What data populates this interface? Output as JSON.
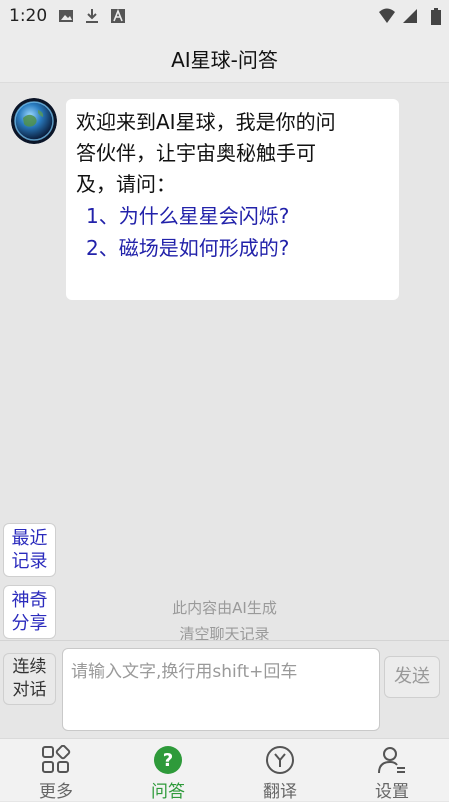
{
  "status_bar": {
    "time": "1:20"
  },
  "header": {
    "title": "AI星球-问答"
  },
  "chat": {
    "greeting_lines": [
      "欢迎来到AI星球，我是你的问",
      "答伙伴，让宇宙奥秘触手可",
      "及，请问："
    ],
    "suggestions": [
      "1、为什么星星会闪烁?",
      "2、磁场是如何形成的?"
    ]
  },
  "side_buttons": {
    "recent": [
      "最近",
      "记录"
    ],
    "share": [
      "神奇",
      "分享"
    ]
  },
  "notices": {
    "ai_generated": "此内容由AI生成",
    "clear_history": "清空聊天记录"
  },
  "input_bar": {
    "continuous": [
      "连续",
      "对话"
    ],
    "placeholder": "请输入文字,换行用shift+回车",
    "send_label": "发送"
  },
  "bottom_nav": {
    "items": [
      {
        "label": "更多",
        "icon": "grid-icon",
        "active": false
      },
      {
        "label": "问答",
        "icon": "question-icon",
        "active": true
      },
      {
        "label": "翻译",
        "icon": "translate-icon",
        "active": false
      },
      {
        "label": "设置",
        "icon": "user-settings-icon",
        "active": false
      }
    ],
    "active_color": "#2e9a3a"
  }
}
